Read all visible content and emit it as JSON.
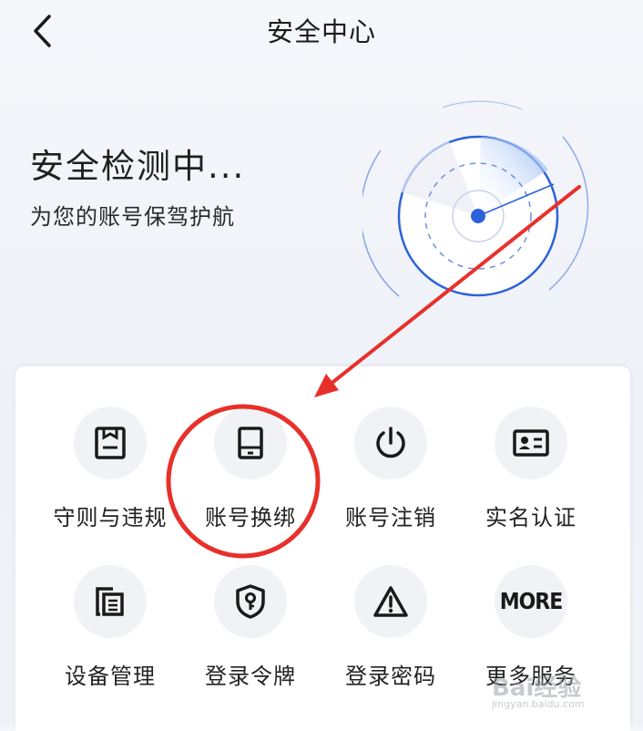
{
  "header": {
    "title": "安全中心"
  },
  "hero": {
    "title": "安全检测中...",
    "subtitle": "为您的账号保驾护航"
  },
  "services": [
    {
      "label": "守则与违规",
      "icon": "rules-document-icon"
    },
    {
      "label": "账号换绑",
      "icon": "phone-device-icon"
    },
    {
      "label": "账号注销",
      "icon": "power-icon"
    },
    {
      "label": "实名认证",
      "icon": "id-card-icon"
    },
    {
      "label": "设备管理",
      "icon": "devices-icon"
    },
    {
      "label": "登录令牌",
      "icon": "shield-key-icon"
    },
    {
      "label": "登录密码",
      "icon": "warning-triangle-icon"
    },
    {
      "label": "更多服务",
      "icon": "more-icon",
      "icon_text": "MORE"
    }
  ],
  "watermark": {
    "logo": "Bai经验",
    "sub": "jingyan.baidu.com"
  },
  "colors": {
    "accent": "#2b62d9",
    "annotation": "#e8302a",
    "radar_sweep": "#8fb4f2"
  }
}
